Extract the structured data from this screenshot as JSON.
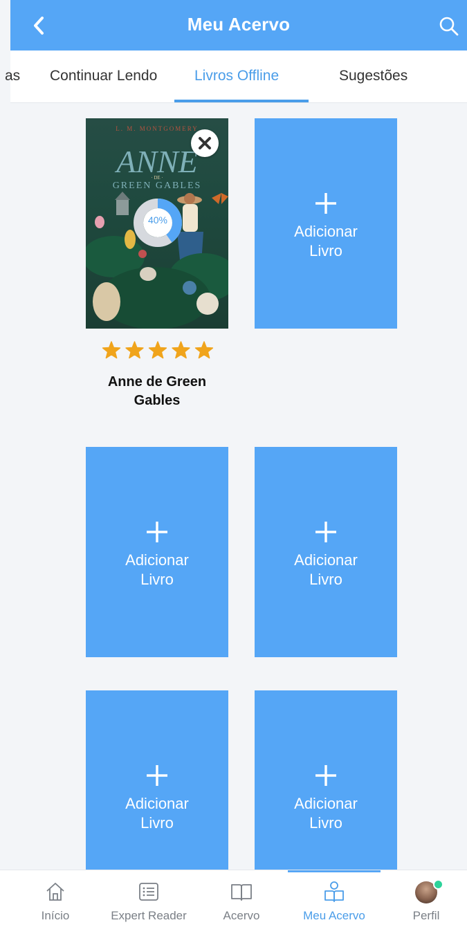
{
  "header": {
    "title": "Meu Acervo",
    "back_icon": "chevron-left-icon",
    "search_icon": "search-icon"
  },
  "tabs": [
    {
      "label": "as",
      "active": false
    },
    {
      "label": "Continuar Lendo",
      "active": false
    },
    {
      "label": "Livros Offline",
      "active": true
    },
    {
      "label": "Sugestões",
      "active": false
    }
  ],
  "book": {
    "title": "Anne de Green Gables",
    "cover_author": "L. M. MONTGOMERY",
    "cover_title_main": "ANNE",
    "cover_title_de": "· DE ·",
    "cover_title_sub": "GREEN GABLES",
    "progress_percent": 40,
    "progress_label": "40%",
    "rating": 5,
    "rating_max": 5
  },
  "add_tile": {
    "plus_icon": "plus-icon",
    "line1": "Adicionar",
    "line2": "Livro"
  },
  "bottom_nav": [
    {
      "label": "Início",
      "icon": "home-icon",
      "active": false
    },
    {
      "label": "Expert Reader",
      "icon": "list-icon",
      "active": false
    },
    {
      "label": "Acervo",
      "icon": "open-book-icon",
      "active": false
    },
    {
      "label": "Meu Acervo",
      "icon": "reader-icon",
      "active": true
    },
    {
      "label": "Perfil",
      "icon": "avatar",
      "active": false
    }
  ],
  "colors": {
    "primary": "#55a6f6",
    "active_text": "#4a9de9",
    "star": "#f0a41c",
    "online_dot": "#2dd39a",
    "background": "#f3f5f8"
  }
}
